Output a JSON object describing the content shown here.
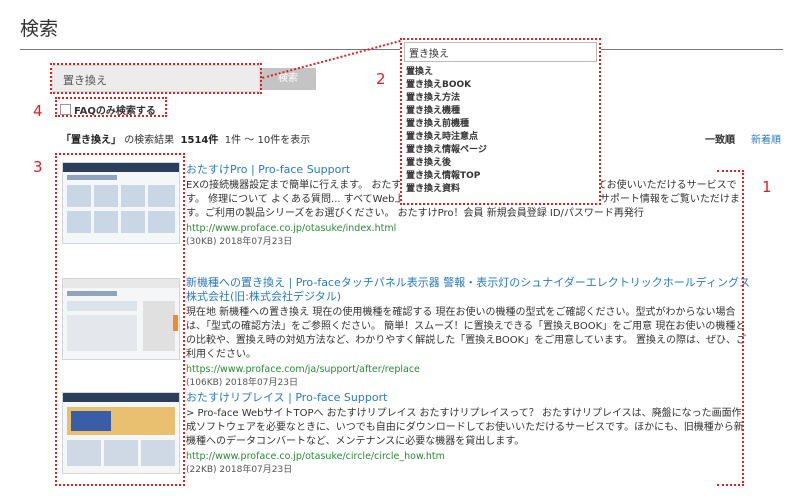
{
  "page": {
    "title": "検索"
  },
  "search": {
    "value": "置き換え",
    "button_label": "検索"
  },
  "faq": {
    "label": "FAQのみ検索する"
  },
  "results_bar": {
    "query_quoted": "「置き換え」",
    "suffix": "の検索結果",
    "total": "1514件",
    "range": "1件 ～ 10件を表示",
    "sort_relevance": "一致順",
    "sort_newest": "新着順"
  },
  "suggest": {
    "input_value": "置き換え",
    "items": [
      "置換え",
      "置き換えBOOK",
      "置き換え方法",
      "置き換え機種",
      "置き換え前機種",
      "置き換え時注意点",
      "置き換え情報ページ",
      "置き換え後",
      "置き換え情報TOP",
      "置き換え資料"
    ]
  },
  "results": [
    {
      "title": "おたすけPro | Pro-face Support",
      "desc": "EXの接続機器設定まで簡単に行えます。 おたすけPro！は、いつでも自由にダウンロードしてお使いいただけるサービスです。 修理について よくある質問... すべてWeb上で行えます。 製品別サポート一覧 製品別でサポート情報をご覧いただけます。ご利用の製品シリーズをお選びください。 おたすけPro！会員 新規会員登録 ID/パスワード再発行",
      "url": "http://www.proface.co.jp/otasuke/index.html",
      "meta": "(30KB) 2018年07月23日"
    },
    {
      "title": "新機種への置き換え | Pro-faceタッチパネル表示器 警報・表示灯のシュナイダーエレクトリックホールディングス株式会社(旧:株式会社デジタル)",
      "desc": "現在地 新機種への置き換え 現在の使用機種を確認する 現在お使いの機種の型式をご確認ください。型式がわからない場合は、「型式の確認方法」をご参照ください。 簡単！スムーズ！に置換えできる「置換えBOOK」をご用意 現在お使いの機種との比較や、置換え時の対処方法など、わかりやすく解説した「置換えBOOK」をご用意しています。 置換えの際は、ぜひ、ご利用ください。",
      "url": "https://www.proface.com/ja/support/after/replace",
      "meta": "(106KB) 2018年07月23日"
    },
    {
      "title": "おたすけリプレイス | Pro-face Support",
      "desc": "> Pro-face WebサイトTOPへ おたすけリプレイス おたすけリプレイスって？ おたすけリプレイスは、廃盤になった画面作成ソフトウェアを必要なときに、いつでも自由にダウンロードしてお使いいただけるサービスです。ほかにも、旧機種から新機種へのデータコンバートなど、メンテナンスに必要な機器を貸出します。",
      "url": "http://www.proface.co.jp/otasuke/circle/circle_how.htm",
      "meta": "(22KB) 2018年07月23日"
    }
  ],
  "callouts": {
    "c1": "1",
    "c2": "2",
    "c3": "3",
    "c4": "4"
  },
  "colors": {
    "callout": "#e02020",
    "link": "#2a7ac2",
    "url": "#2a8a36"
  }
}
